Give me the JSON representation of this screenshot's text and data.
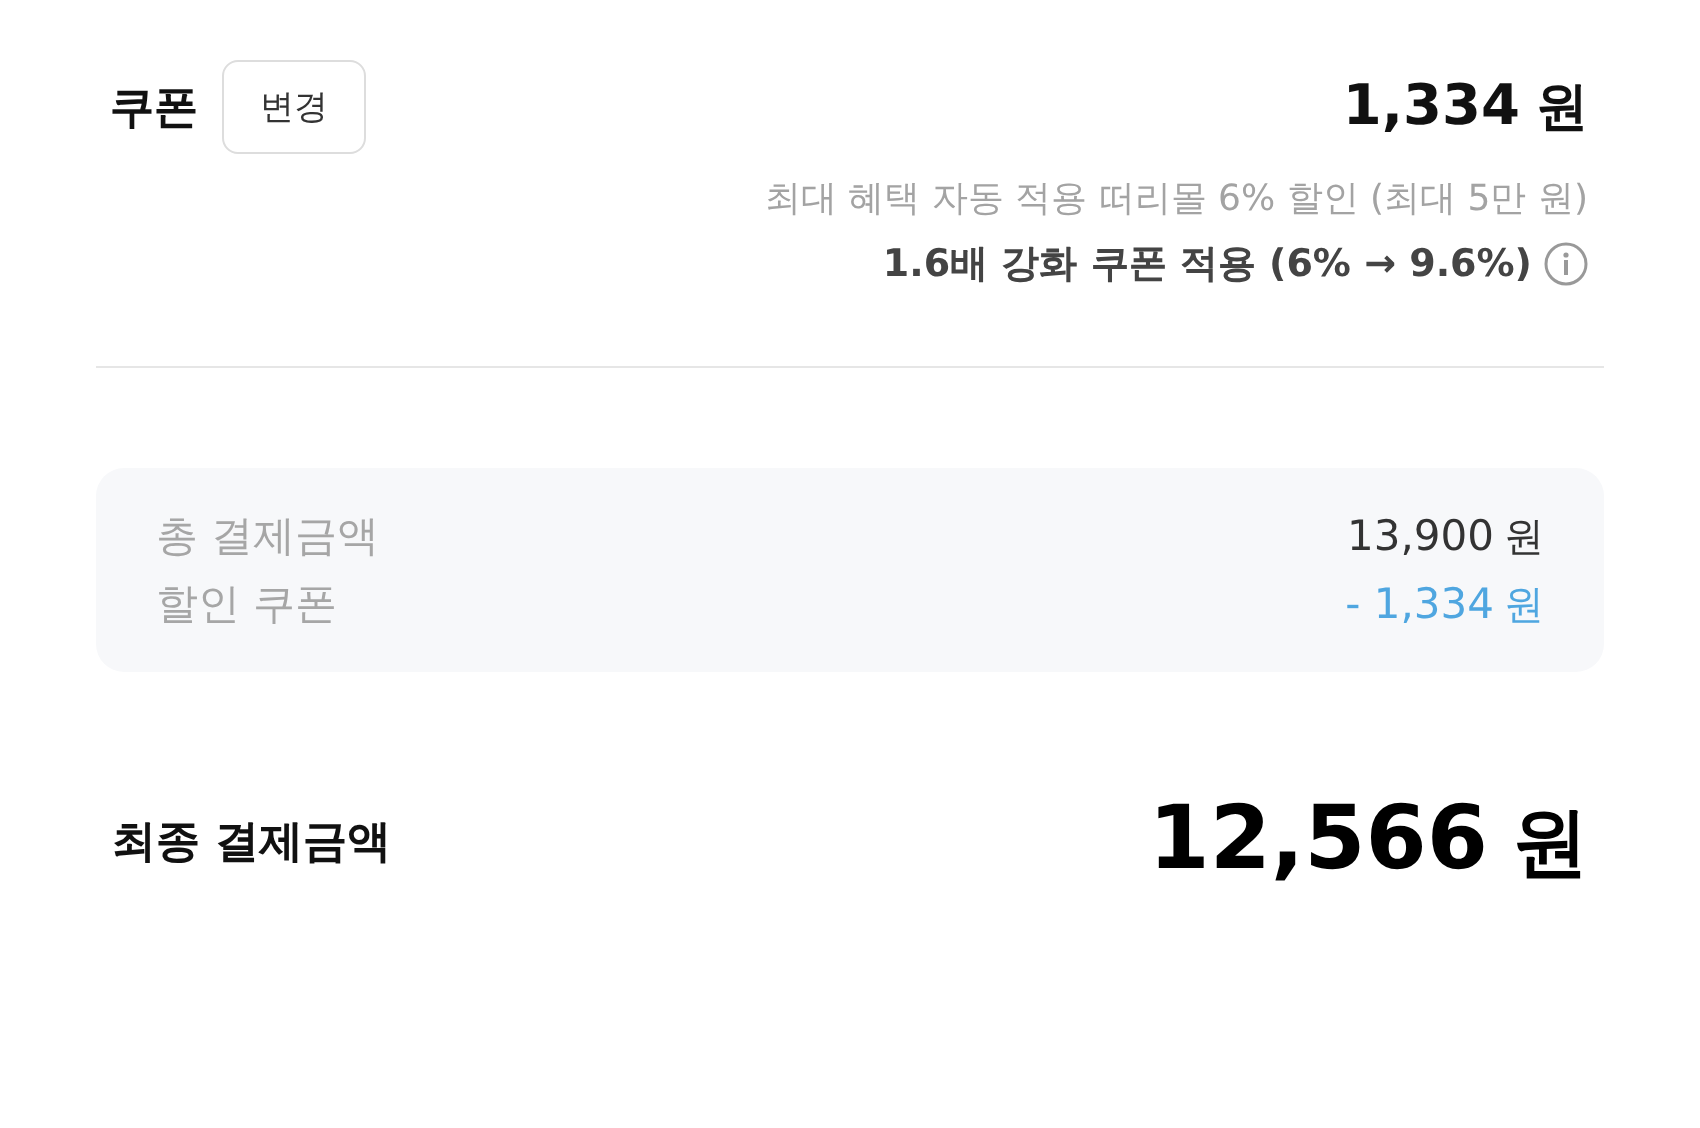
{
  "coupon": {
    "label": "쿠폰",
    "change_button": "변경",
    "amount": "1,334",
    "unit": "원",
    "note": "최대 혜택 자동 적용 떠리몰 6% 할인 (최대 5만 원)",
    "boost": "1.6배 강화 쿠폰 적용 (6% → 9.6%)"
  },
  "summary": [
    {
      "kind": "plain",
      "label": "총 결제금액",
      "amount": "13,900",
      "unit": "원"
    },
    {
      "kind": "discount",
      "label": "할인 쿠폰",
      "amount": "- 1,334",
      "unit": "원"
    }
  ],
  "final": {
    "label": "최종 결제금액",
    "amount": "12,566",
    "unit": "원"
  }
}
